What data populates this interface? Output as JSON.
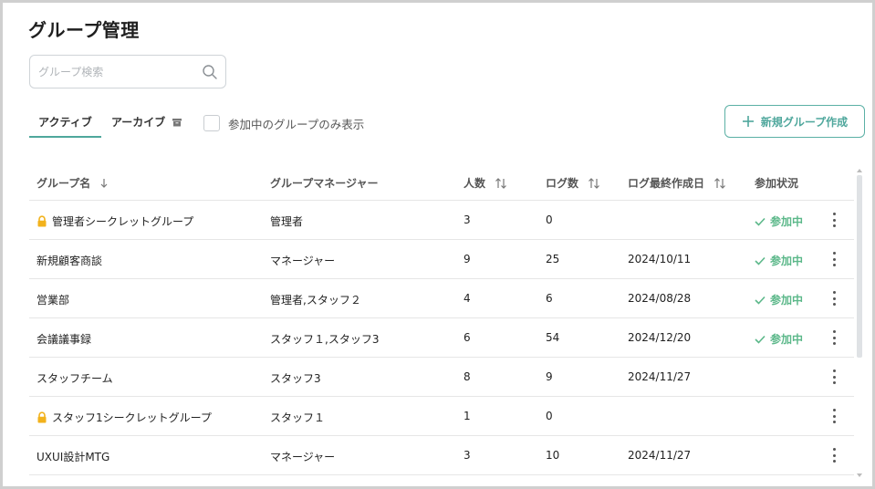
{
  "page": {
    "title": "グループ管理"
  },
  "search": {
    "placeholder": "グループ検索",
    "value": ""
  },
  "tabs": [
    {
      "label": "アクティブ",
      "active": true
    },
    {
      "label": "アーカイブ",
      "icon": "archive-icon",
      "active": false
    }
  ],
  "filter": {
    "label": "参加中のグループのみ表示",
    "checked": false
  },
  "new_button": {
    "label": "新規グループ作成",
    "icon": "plus-icon"
  },
  "table": {
    "headers": {
      "name": "グループ名",
      "manager": "グループマネージャー",
      "members": "人数",
      "logs": "ログ数",
      "last_log": "ログ最終作成日",
      "status": "参加状況"
    },
    "rows": [
      {
        "name": "管理者シークレットグループ",
        "secret": true,
        "manager": "管理者",
        "members": "3",
        "logs": "0",
        "last_log": "",
        "status": "参加中"
      },
      {
        "name": "新規顧客商談",
        "secret": false,
        "manager": "マネージャー",
        "members": "9",
        "logs": "25",
        "last_log": "2024/10/11",
        "status": "参加中"
      },
      {
        "name": "営業部",
        "secret": false,
        "manager": "管理者,スタッフ２",
        "members": "4",
        "logs": "6",
        "last_log": "2024/08/28",
        "status": "参加中"
      },
      {
        "name": "会議議事録",
        "secret": false,
        "manager": "スタッフ１,スタッフ3",
        "members": "6",
        "logs": "54",
        "last_log": "2024/12/20",
        "status": "参加中"
      },
      {
        "name": "スタッフチーム",
        "secret": false,
        "manager": "スタッフ3",
        "members": "8",
        "logs": "9",
        "last_log": "2024/11/27",
        "status": ""
      },
      {
        "name": "スタッフ1シークレットグループ",
        "secret": true,
        "manager": "スタッフ１",
        "members": "1",
        "logs": "0",
        "last_log": "",
        "status": ""
      },
      {
        "name": "UXUI設計MTG",
        "secret": false,
        "manager": "マネージャー",
        "members": "3",
        "logs": "10",
        "last_log": "2024/11/27",
        "status": ""
      }
    ]
  },
  "colors": {
    "accent": "#4fa79c",
    "status": "#5cb88a",
    "lock": "#f2b21c"
  }
}
